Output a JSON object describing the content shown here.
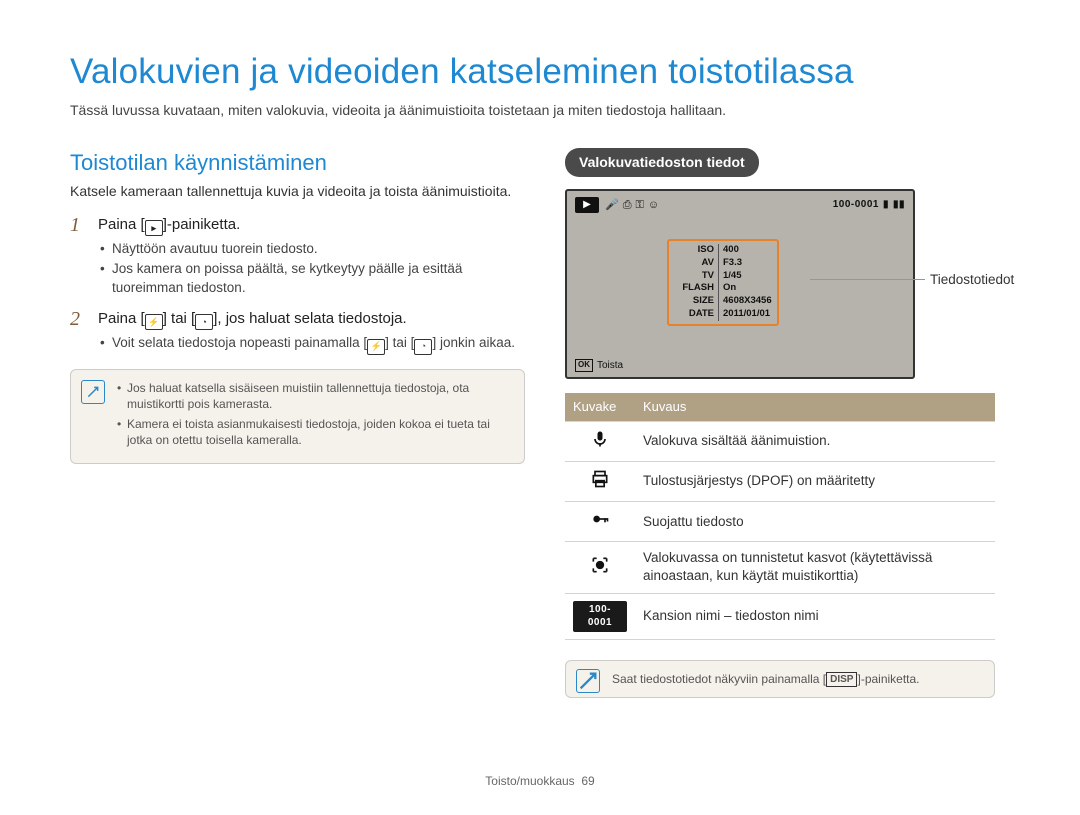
{
  "title": "Valokuvien ja videoiden katseleminen toistotilassa",
  "intro": "Tässä luvussa kuvataan, miten valokuvia, videoita ja äänimuistioita toistetaan ja miten tiedostoja hallitaan.",
  "left": {
    "section_title": "Toistotilan käynnistäminen",
    "section_intro": "Katsele kameraan tallennettuja kuvia ja videoita ja toista äänimuistioita.",
    "step1_num": "1",
    "step1_pre": "Paina [",
    "step1_post": "]-painiketta.",
    "step1_bullets": [
      "Näyttöön avautuu tuorein tiedosto.",
      "Jos kamera on poissa päältä, se kytkeytyy päälle ja esittää tuoreimman tiedoston."
    ],
    "step2_num": "2",
    "step2_pre": "Paina [",
    "step2_mid": "] tai [",
    "step2_post": "], jos haluat selata tiedostoja.",
    "step2_bullet_pre": "Voit selata tiedostoja nopeasti painamalla [",
    "step2_bullet_mid": "] tai [",
    "step2_bullet_post": "] jonkin aikaa.",
    "note_items": [
      "Jos haluat katsella sisäiseen muistiin tallennettuja tiedostoja, ota muistikortti pois kamerasta.",
      "Kamera ei toista asianmukaisesti tiedostoja, joiden kokoa ei tueta tai jotka on otettu toisella kameralla."
    ]
  },
  "right": {
    "pill": "Valokuvatiedoston tiedot",
    "callout": "Tiedostotiedot",
    "screen": {
      "folder": "100-0001",
      "toista": "Toista",
      "ok": "OK",
      "info": {
        "iso_k": "ISO",
        "iso_v": "400",
        "av_k": "AV",
        "av_v": "F3.3",
        "tv_k": "TV",
        "tv_v": "1/45",
        "flash_k": "FLASH",
        "flash_v": "On",
        "size_k": "SIZE",
        "size_v": "4608X3456",
        "date_k": "DATE",
        "date_v": "2011/01/01"
      }
    },
    "table": {
      "h1": "Kuvake",
      "h2": "Kuvaus",
      "r1": "Valokuva sisältää äänimuistion.",
      "r2": "Tulostusjärjestys (DPOF) on määritetty",
      "r3": "Suojattu tiedosto",
      "r4": "Valokuvassa on tunnistetut kasvot (käytettävissä ainoastaan, kun käytät muistikorttia)",
      "r5_icon": "100-0001",
      "r5": "Kansion nimi – tiedoston nimi"
    },
    "tip_pre": "Saat tiedostotiedot näkyviin painamalla [",
    "tip_disp": "DISP",
    "tip_post": "]-painiketta."
  },
  "footer_label": "Toisto/muokkaus",
  "footer_page": "69"
}
